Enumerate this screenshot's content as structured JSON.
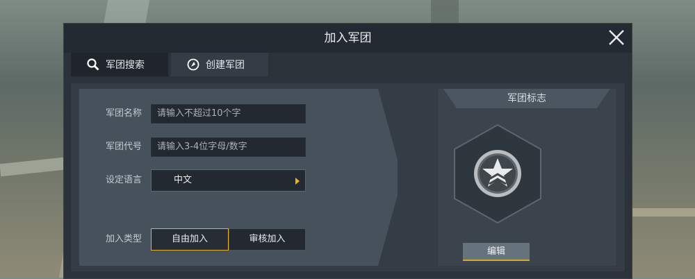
{
  "dialog": {
    "title": "加入军团",
    "close_icon": "close-icon"
  },
  "tabs": [
    {
      "label": "军团搜索",
      "icon": "search-icon",
      "active": false
    },
    {
      "label": "创建军团",
      "icon": "create-icon",
      "active": true
    }
  ],
  "form": {
    "name_label": "军团名称",
    "name_placeholder": "请输入不超过10个字",
    "code_label": "军团代号",
    "code_placeholder": "请输入3-4位字母/数字",
    "language_label": "设定语言",
    "language_value": "中文",
    "join_type_label": "加入类型",
    "join_type_options": [
      "自由加入",
      "审核加入"
    ],
    "join_type_selected": "自由加入"
  },
  "logo": {
    "header": "军团标志",
    "emblem_icon": "star-chevron-emblem-icon",
    "edit_label": "编辑"
  },
  "colors": {
    "accent": "#e3b12a",
    "panel": "#2b323a",
    "form_bg": "#46515b"
  }
}
